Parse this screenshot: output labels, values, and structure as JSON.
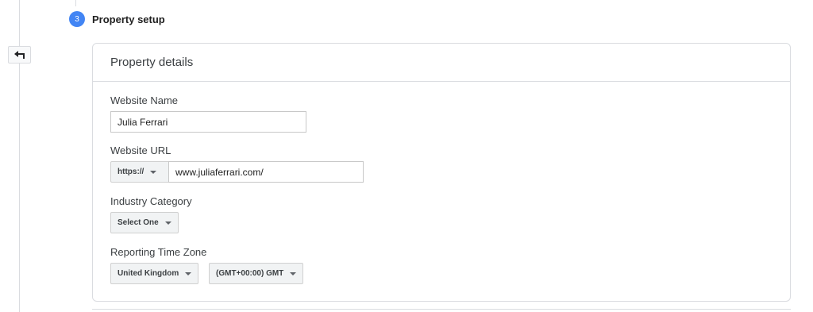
{
  "step": {
    "number": "3",
    "title": "Property setup"
  },
  "card": {
    "title": "Property details"
  },
  "fields": {
    "website_name": {
      "label": "Website Name",
      "value": "Julia Ferrari"
    },
    "website_url": {
      "label": "Website URL",
      "protocol": "https://",
      "value": "www.juliaferrari.com/"
    },
    "industry_category": {
      "label": "Industry Category",
      "selected": "Select One"
    },
    "reporting_time_zone": {
      "label": "Reporting Time Zone",
      "country": "United Kingdom",
      "zone": "(GMT+00:00) GMT"
    }
  },
  "icons": {
    "back": "back-arrow-icon",
    "caret": "caret-down-icon"
  },
  "colors": {
    "step_accent": "#4285f4",
    "border": "#dadce0"
  }
}
